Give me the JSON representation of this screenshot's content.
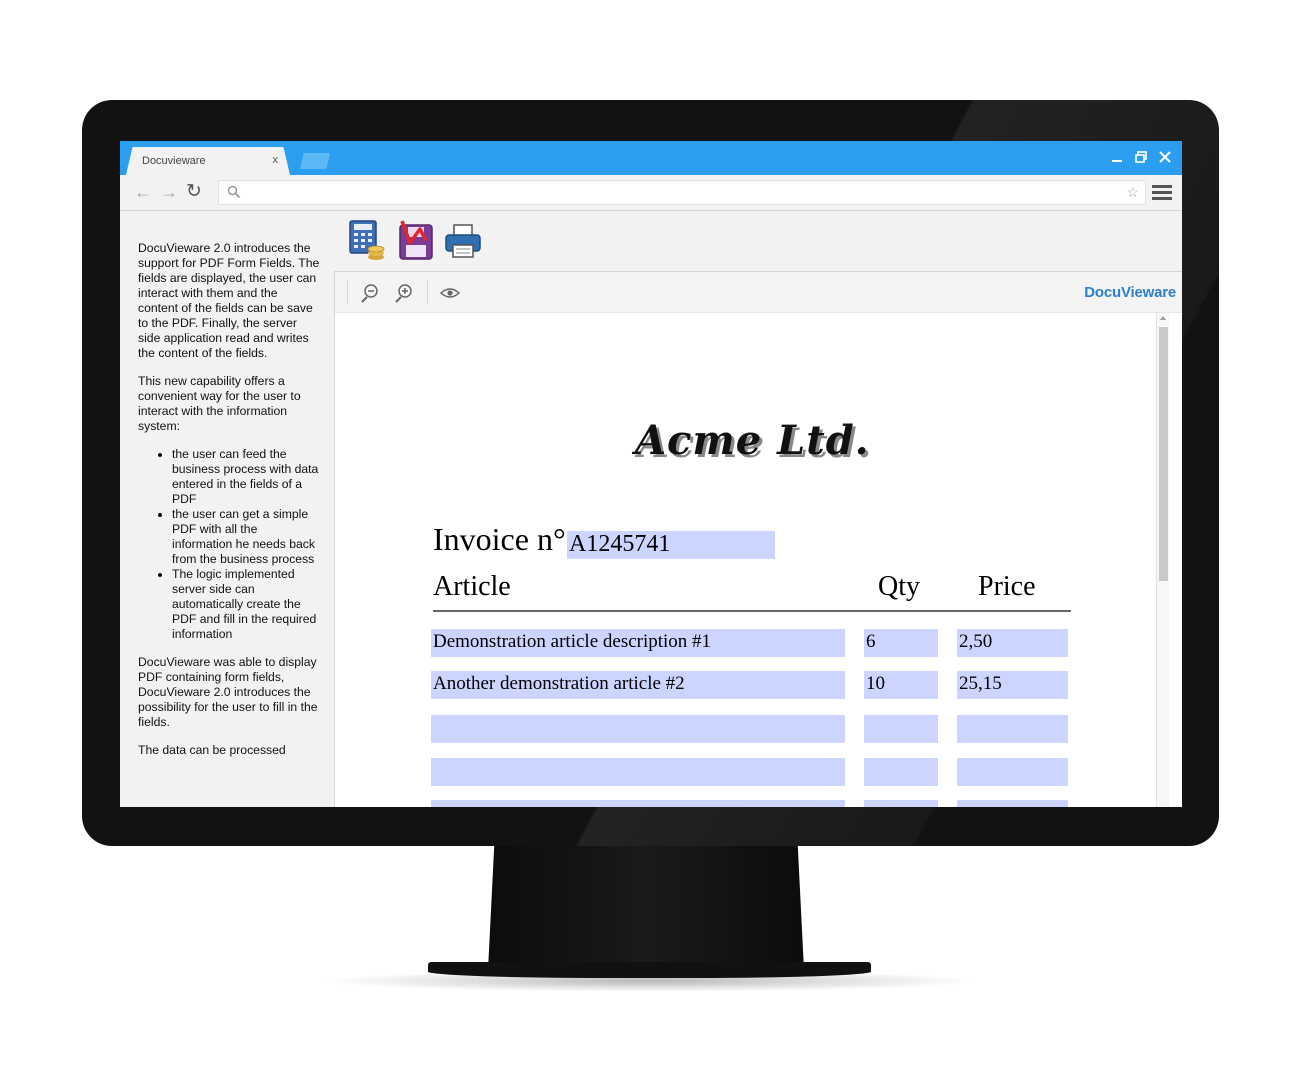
{
  "browser": {
    "tab_title": "Docuvieware",
    "tab_close": "x"
  },
  "sidebar": {
    "paragraph1": "DocuVieware 2.0 introduces the support for PDF Form Fields. The fields are displayed, the user can interact with them and the content of the fields can be save to the PDF. Finally, the server side application read and writes the content of the fields.",
    "paragraph2": "This new capability offers a convenient way for the user to interact with the information system:",
    "bullets": [
      "the user can feed the business process with data entered in the fields of a PDF",
      "the user can get a simple PDF with all the information he needs back from the business process",
      "The logic implemented server side can automatically create the PDF and fill in the required information"
    ],
    "paragraph3": "DocuVieware was able to display PDF containing form fields, DocuVieware 2.0 introduces the possibility for the user to fill in the fields.",
    "paragraph4": "The data can be processed"
  },
  "toolbar": {
    "icons": [
      "calculator-coins-icon",
      "pdf-save-icon",
      "printer-icon"
    ]
  },
  "viewer": {
    "brand": "DocuVieware",
    "tools": [
      "zoom-out-icon",
      "zoom-in-icon",
      "eye-icon"
    ]
  },
  "document": {
    "company": "Acme Ltd.",
    "invoice_label": "Invoice n°",
    "invoice_number": "A1245741",
    "columns": {
      "article": "Article",
      "qty": "Qty",
      "price": "Price"
    },
    "rows": [
      {
        "article": "Demonstration article description #1",
        "qty": "6",
        "price": "2,50"
      },
      {
        "article": "Another demonstration article #2",
        "qty": "10",
        "price": "25,15"
      },
      {
        "article": "",
        "qty": "",
        "price": ""
      },
      {
        "article": "",
        "qty": "",
        "price": ""
      },
      {
        "article": "",
        "qty": "",
        "price": ""
      }
    ],
    "field_color": "#ccd5ff"
  },
  "colors": {
    "tabbar": "#2c9ef0",
    "brand": "#2c7fcf"
  }
}
